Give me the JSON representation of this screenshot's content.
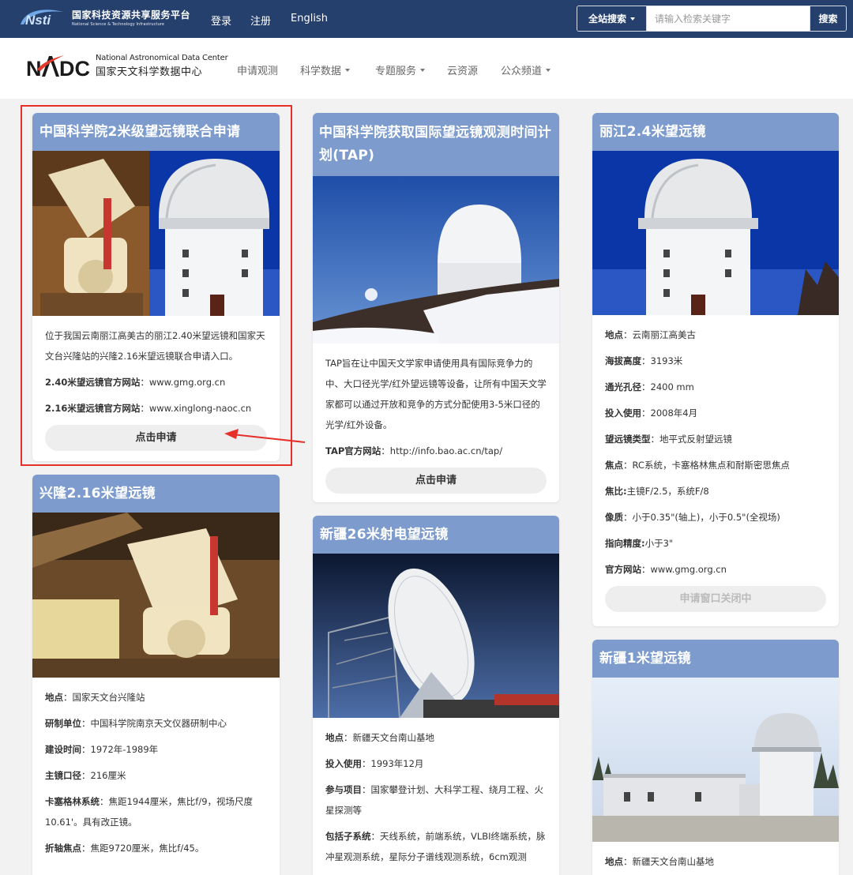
{
  "topbar": {
    "logo_mark": "Nsti",
    "title_cn": "国家科技资源共享服务平台",
    "title_en": "National Science & Technology Infrastructure",
    "links": [
      "登录",
      "注册",
      "English"
    ],
    "search_scope": "全站搜索",
    "search_placeholder": "请输入检索关键字",
    "search_button": "搜索"
  },
  "nav": {
    "logo_en": "National Astronomical Data Center",
    "logo_cn": "国家天文科学数据中心",
    "items": [
      "申请观测",
      "科学数据",
      "专题服务",
      "云资源",
      "公众频道"
    ]
  },
  "cards": {
    "c1": {
      "title": "中国科学院2米级望远镜联合申请",
      "desc": "位于我国云南丽江高美古的丽江2.40米望远镜和国家天文台兴隆站的兴隆2.16米望远镜联合申请入口。",
      "site1_label": "2.40米望远镜官方网站",
      "site1_value": "：www.gmg.org.cn",
      "site2_label": "2.16米望远镜官方网站",
      "site2_value": "：www.xinglong-naoc.cn",
      "button": "点击申请"
    },
    "c2": {
      "title": "中国科学院获取国际望远镜观测时间计划(TAP)",
      "desc": "TAP旨在让中国天文学家申请使用具有国际竞争力的中、大口径光学/红外望远镜等设备，让所有中国天文学家都可以通过开放和竞争的方式分配使用3-5米口径的光学/红外设备。",
      "site_label": "TAP官方网站",
      "site_value": "：http://info.bao.ac.cn/tap/",
      "button": "点击申请"
    },
    "c3": {
      "title": "丽江2.4米望远镜",
      "lines": [
        {
          "label": "地点",
          "value": "：云南丽江高美古"
        },
        {
          "label": "海拔高度",
          "value": "：3193米"
        },
        {
          "label": "通光孔径",
          "value": "：2400 mm"
        },
        {
          "label": "投入使用",
          "value": "：2008年4月"
        },
        {
          "label": "望远镜类型",
          "value": "：地平式反射望远镜"
        },
        {
          "label": "焦点",
          "value": "：RC系统，卡塞格林焦点和耐斯密思焦点"
        },
        {
          "label": "焦比:",
          "value": "主镜F/2.5，系统F/8"
        },
        {
          "label": "像质",
          "value": "：小于0.35\"(轴上)，小于0.5\"(全视场)"
        },
        {
          "label": "指向精度:",
          "value": "小于3\""
        },
        {
          "label": "官方网站",
          "value": "：www.gmg.org.cn"
        }
      ],
      "button": "申请窗口关闭中"
    },
    "c4": {
      "title": "兴隆2.16米望远镜",
      "lines": [
        {
          "label": "地点",
          "value": "：国家天文台兴隆站"
        },
        {
          "label": "研制单位",
          "value": "：中国科学院南京天文仪器研制中心"
        },
        {
          "label": "建设时间",
          "value": "：1972年-1989年"
        },
        {
          "label": "主镜口径",
          "value": "：216厘米"
        },
        {
          "label": "卡塞格林系统",
          "value": "：焦距1944厘米，焦比f/9，视场尺度10.61'。具有改正镜。"
        },
        {
          "label": "折轴焦点",
          "value": "：焦距9720厘米，焦比f/45。"
        }
      ]
    },
    "c5": {
      "title": "新疆26米射电望远镜",
      "lines": [
        {
          "label": "地点",
          "value": "：新疆天文台南山基地"
        },
        {
          "label": "投入使用",
          "value": "：1993年12月"
        },
        {
          "label": "参与项目",
          "value": "：国家攀登计划、大科学工程、绕月工程、火星探测等"
        },
        {
          "label": "包括子系统",
          "value": "：天线系统，前端系统，VLBI终端系统，脉冲星观测系统，星际分子谱线观测系统，6cm观测"
        }
      ]
    },
    "c6": {
      "title": "新疆1米望远镜",
      "lines": [
        {
          "label": "地点",
          "value": "：新疆天文台南山基地"
        }
      ]
    }
  },
  "colors": {
    "topbar": "#26406e",
    "card_header": "#7d9ccd",
    "highlight": "#e8302b",
    "page_bg": "#f2f2f2"
  }
}
